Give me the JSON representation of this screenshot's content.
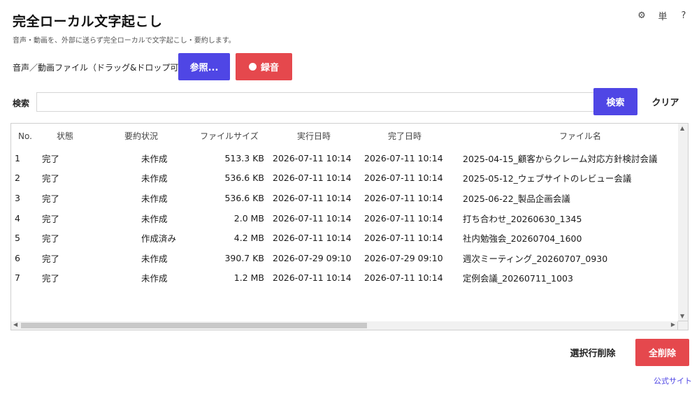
{
  "app": {
    "title": "完全ローカル文字起こし",
    "subtitle": "音声・動画を、外部に送らず完全ローカルで文字起こし・要約します。"
  },
  "top_icons": [
    {
      "name": "gear-icon",
      "glyph": "⚙"
    },
    {
      "name": "word-icon",
      "glyph": "単"
    },
    {
      "name": "help-icon",
      "glyph": "?"
    }
  ],
  "file": {
    "label": "音声／動画ファイル（ドラッグ&ドロップ可）：",
    "browse_label": "参照...",
    "record_label": "録音"
  },
  "search": {
    "label": "検索",
    "value": "",
    "placeholder": "",
    "button_label": "検索",
    "clear_label": "クリア"
  },
  "table": {
    "headers": [
      "No.",
      "状態",
      "要約状況",
      "ファイルサイズ",
      "実行日時",
      "完了日時",
      "ファイル名"
    ],
    "rows": [
      [
        "1",
        "完了",
        "未作成",
        "513.3 KB",
        "2026-07-11 10:14",
        "2026-07-11 10:14",
        "2025-04-15_顧客からクレーム対応方針検討会議"
      ],
      [
        "2",
        "完了",
        "未作成",
        "536.6 KB",
        "2026-07-11 10:14",
        "2026-07-11 10:14",
        "2025-05-12_ウェブサイトのレビュー会議"
      ],
      [
        "3",
        "完了",
        "未作成",
        "536.6 KB",
        "2026-07-11 10:14",
        "2026-07-11 10:14",
        "2025-06-22_製品企画会議"
      ],
      [
        "4",
        "完了",
        "未作成",
        "2.0 MB",
        "2026-07-11 10:14",
        "2026-07-11 10:14",
        "打ち合わせ_20260630_1345"
      ],
      [
        "5",
        "完了",
        "作成済み",
        "4.2 MB",
        "2026-07-11 10:14",
        "2026-07-11 10:14",
        "社内勉強会_20260704_1600"
      ],
      [
        "6",
        "完了",
        "未作成",
        "390.7 KB",
        "2026-07-29 09:10",
        "2026-07-29 09:10",
        "週次ミーティング_20260707_0930"
      ],
      [
        "7",
        "完了",
        "未作成",
        "1.2 MB",
        "2026-07-11 10:14",
        "2026-07-11 10:14",
        "定例会議_20260711_1003"
      ]
    ]
  },
  "footer": {
    "delete_selected_label": "選択行削除",
    "delete_all_label": "全削除",
    "site_link": "公式サイト"
  },
  "colors": {
    "primary": "#4f46e5",
    "danger": "#e5484d",
    "link": "#4f46e5"
  }
}
